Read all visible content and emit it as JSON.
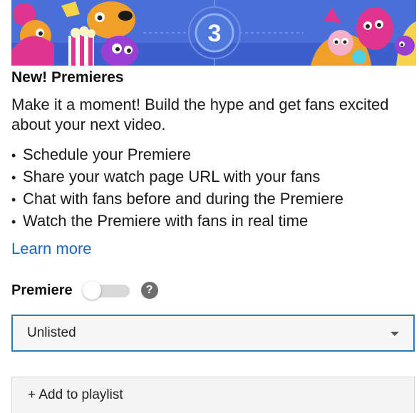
{
  "banner": {
    "countdown_number": "3",
    "background_color": "#4a6fd8"
  },
  "premieres": {
    "title": "New! Premieres",
    "description": "Make it a moment! Build the hype and get fans excited about your next video.",
    "bullets": [
      "Schedule your Premiere",
      "Share your watch page URL with your fans",
      "Chat with fans before and during the Premiere",
      "Watch the Premiere with fans in real time"
    ],
    "learn_more": "Learn more",
    "link_color": "#1867c0"
  },
  "premiere_toggle": {
    "label": "Premiere",
    "enabled": false,
    "help_icon": "?"
  },
  "visibility_select": {
    "selected": "Unlisted",
    "border_color": "#2b7bb9"
  },
  "playlist": {
    "add_label": "+ Add to playlist"
  }
}
